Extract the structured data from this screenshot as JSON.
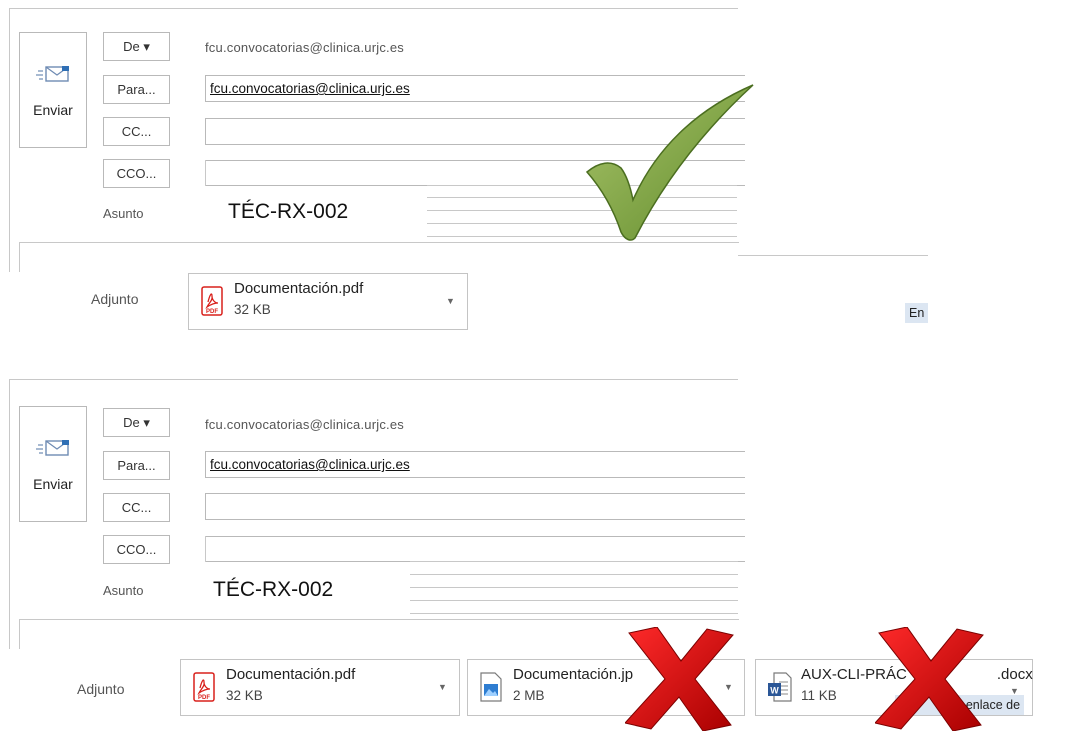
{
  "top": {
    "send_label": "Enviar",
    "from_button": "De ▾",
    "from_address": "fcu.convocatorias@clinica.urjc.es",
    "to_button": "Para...",
    "to_value": "fcu.convocatorias@clinica.urjc.es",
    "cc_button": "CC...",
    "bcc_button": "CCO...",
    "subject_label": "Asunto",
    "subject_value": "TÉC-RX-002",
    "attach_label": "Adjunto",
    "attachments": [
      {
        "name": "Documentación.pdf",
        "size": "32 KB",
        "type": "pdf"
      }
    ],
    "tooltip": "En",
    "verdict": "check-mark"
  },
  "bottom": {
    "send_label": "Enviar",
    "from_button": "De ▾",
    "from_address": "fcu.convocatorias@clinica.urjc.es",
    "to_button": "Para...",
    "to_value": "fcu.convocatorias@clinica.urjc.es",
    "cc_button": "CC...",
    "bcc_button": "CCO...",
    "subject_label": "Asunto",
    "subject_value": "TÉC-RX-002",
    "attach_label": "Adjunto",
    "attachments": [
      {
        "name": "Documentación.pdf",
        "size": "32 KB",
        "type": "pdf"
      },
      {
        "name": "Documentación.jp",
        "size": "2 MB",
        "type": "image"
      },
      {
        "name": "AUX-CLI-PRÁC",
        "name_suffix": ".docx",
        "size": "11 KB",
        "type": "word"
      }
    ],
    "tooltip": "mo enlace de",
    "verdict": "x-marks"
  },
  "colors": {
    "check_green": "#7aa23e",
    "x_red": "#d40000",
    "pdf_red": "#d9201b",
    "word_blue": "#2b5797",
    "tooltip_bg": "#dce6f2"
  }
}
